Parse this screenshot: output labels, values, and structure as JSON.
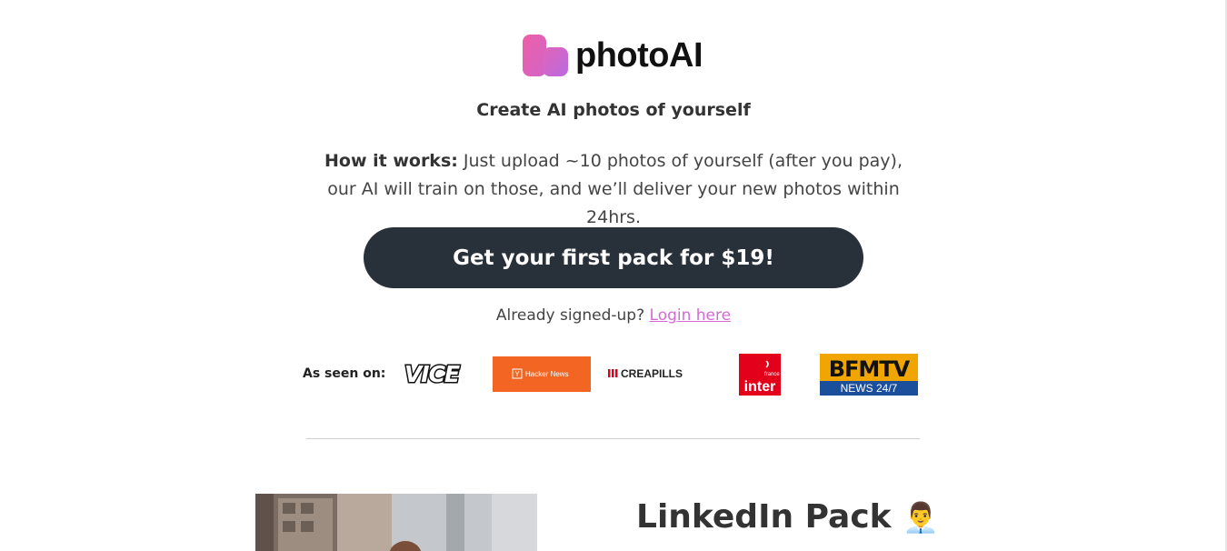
{
  "brand": {
    "name": "photoAI",
    "logo_colors": {
      "primary": "#e85aa8",
      "secondary": "#c96ad8"
    }
  },
  "hero": {
    "tagline": "Create AI photos of yourself",
    "how_it_works_label": "How it works:",
    "how_it_works_text": " Just upload ~10 photos of yourself (after you pay), our AI will train on those, and we’ll deliver your new photos within 24hrs.",
    "cta_label": "Get your first pack for $19!",
    "cta_color": "#28313a"
  },
  "signin": {
    "prompt": "Already signed-up?",
    "link_label": "Login here",
    "link_color": "#d36ad6"
  },
  "press": {
    "label": "As seen on:",
    "logos": [
      {
        "name": "VICE",
        "icon": "vice-logo"
      },
      {
        "name": "Hacker News",
        "icon": "hacker-news-logo",
        "color": "#f26522"
      },
      {
        "name": "CREAPILLS",
        "icon": "creapills-logo"
      },
      {
        "name": "inter",
        "small": "france",
        "icon": "france-inter-logo",
        "color": "#e2001a"
      },
      {
        "name": "BFMTV",
        "small": "NEWS 24/7",
        "icon": "bfmtv-logo"
      }
    ]
  },
  "pack": {
    "title": "LinkedIn Pack",
    "emoji": "👨‍💼"
  }
}
